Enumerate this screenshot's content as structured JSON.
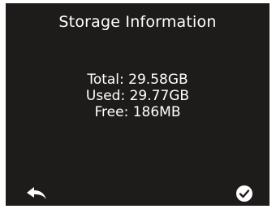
{
  "screen": {
    "title": "Storage Information",
    "storage": {
      "total": "Total: 29.58GB",
      "used": "Used: 29.77GB",
      "free": "Free: 186MB"
    },
    "actions": {
      "back_icon": "back-arrow-icon",
      "confirm_icon": "checkmark-circle-icon"
    },
    "colors": {
      "background": "#1e1b1b",
      "foreground": "#ffffff"
    }
  }
}
